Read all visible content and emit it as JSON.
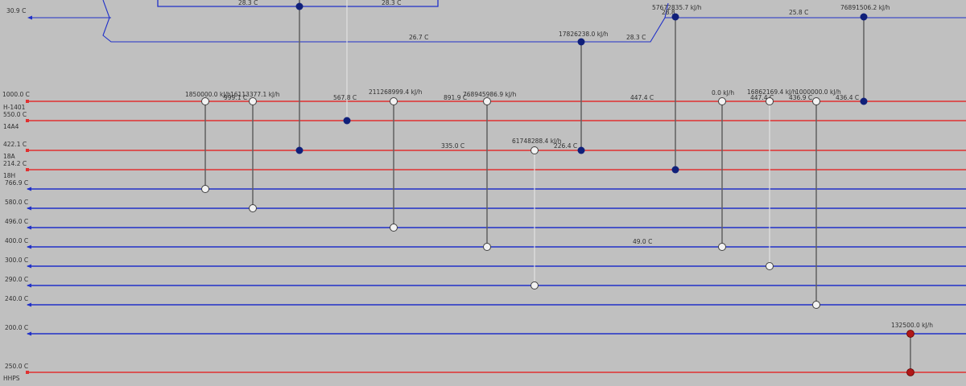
{
  "colors": {
    "hot": "#e03030",
    "cold": "#2030c8",
    "bg": "#c0c0c0",
    "link": "#606060",
    "text": "#303030"
  },
  "top_labels": {
    "left_temp": "30.9 C",
    "t_28_3_a": "28.3 C",
    "t_28_3_b": "28.3 C",
    "t_26_7": "26.7 C",
    "t_28_3_c": "28.3 C",
    "duty_1": "17826238.0 kJ/h",
    "duty_2": "57672835.7 kJ/h",
    "t_28_8": "28.8",
    "t_25_8": "25.8 C",
    "duty_3": "76891506.2 kJ/h"
  },
  "streams": [
    {
      "type": "hot",
      "temp": "1000.0 C",
      "name": "H-1401"
    },
    {
      "type": "hot",
      "temp": "550.0 C",
      "name": "14A4"
    },
    {
      "type": "hot",
      "temp": "422.1 C",
      "name": "18A"
    },
    {
      "type": "hot",
      "temp": "214.2 C",
      "name": "18H"
    },
    {
      "type": "cold",
      "temp": "766.9 C",
      "name": ""
    },
    {
      "type": "cold",
      "temp": "580.0 C",
      "name": ""
    },
    {
      "type": "cold",
      "temp": "496.0 C",
      "name": ""
    },
    {
      "type": "cold",
      "temp": "400.0 C",
      "name": ""
    },
    {
      "type": "cold",
      "temp": "300.0 C",
      "name": ""
    },
    {
      "type": "cold",
      "temp": "290.0 C",
      "name": ""
    },
    {
      "type": "cold",
      "temp": "240.0 C",
      "name": ""
    },
    {
      "type": "cold",
      "temp": "200.0 C",
      "name": ""
    },
    {
      "type": "hot",
      "temp": "250.0 C",
      "name": "HHPS"
    }
  ],
  "annotations": [
    "1850000.0 kJ/h",
    "999.1 C",
    "16113377.1 kJ/h",
    "567.8 C",
    "211268999.4 kJ/h",
    "891.9 C",
    "768945986.9 kJ/h",
    "447.4 C",
    "0.0 kJ/h",
    "16862169.4 kJ/h",
    "447.4 C",
    "1000000.0 kJ/h",
    "436.9 C",
    "436.4 C",
    "335.0 C",
    "61748288.4 kJ/h",
    "226.4 C",
    "49.0 C",
    "132500.0 kJ/h"
  ],
  "exchangers": [
    {
      "id": "ex-1",
      "style": "white"
    },
    {
      "id": "ex-2",
      "style": "white"
    },
    {
      "id": "ex-3",
      "style": "white"
    },
    {
      "id": "ex-4",
      "style": "white"
    },
    {
      "id": "ex-5",
      "style": "white"
    },
    {
      "id": "ex-6",
      "style": "white"
    },
    {
      "id": "ex-7",
      "style": "white"
    },
    {
      "id": "ex-8",
      "style": "white"
    },
    {
      "id": "ex-9",
      "style": "navy"
    },
    {
      "id": "ex-10",
      "style": "navy"
    },
    {
      "id": "ex-11",
      "style": "navy"
    },
    {
      "id": "ex-12",
      "style": "navy"
    },
    {
      "id": "ex-13",
      "style": "navy"
    },
    {
      "id": "ex-14",
      "style": "red"
    }
  ]
}
